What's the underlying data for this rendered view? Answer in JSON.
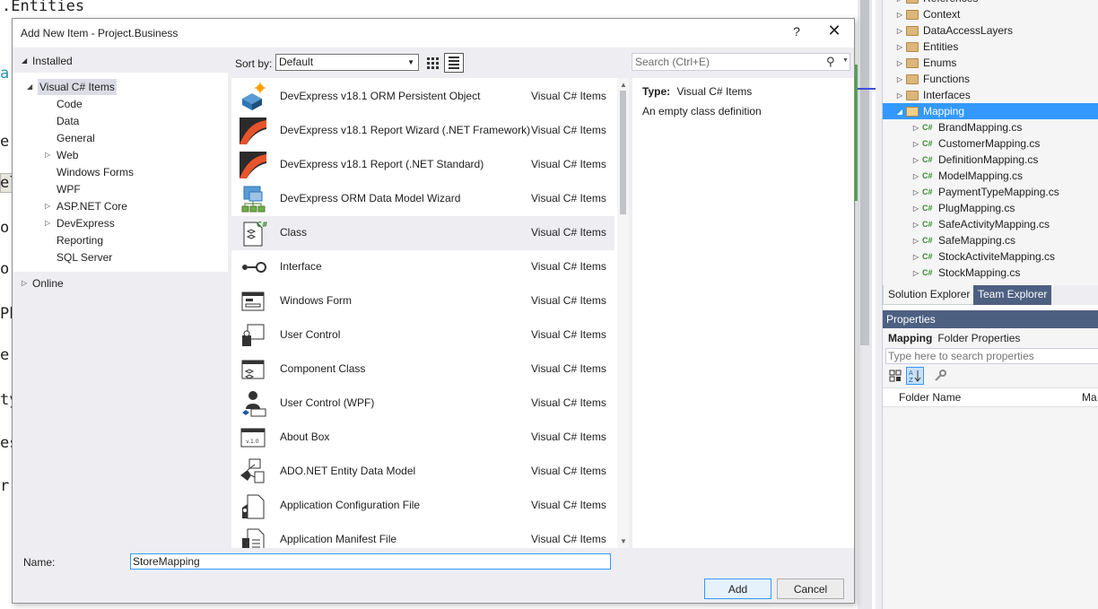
{
  "editor": {
    "fragments": [
      ".Entities",
      "a:",
      "e(",
      "el",
      "or",
      "or",
      "Ph",
      "e",
      "ty",
      "es",
      "r:"
    ]
  },
  "solution_explorer": {
    "items": [
      {
        "label": "References",
        "kind": "folder"
      },
      {
        "label": "Context",
        "kind": "folder"
      },
      {
        "label": "DataAccessLayers",
        "kind": "folder"
      },
      {
        "label": "Entities",
        "kind": "folder"
      },
      {
        "label": "Enums",
        "kind": "folder"
      },
      {
        "label": "Functions",
        "kind": "folder"
      },
      {
        "label": "Interfaces",
        "kind": "folder"
      },
      {
        "label": "Mapping",
        "kind": "folder-open",
        "selected": true
      },
      {
        "label": "BrandMapping.cs",
        "kind": "cs"
      },
      {
        "label": "CustomerMapping.cs",
        "kind": "cs"
      },
      {
        "label": "DefinitionMapping.cs",
        "kind": "cs"
      },
      {
        "label": "ModelMapping.cs",
        "kind": "cs"
      },
      {
        "label": "PaymentTypeMapping.cs",
        "kind": "cs"
      },
      {
        "label": "PlugMapping.cs",
        "kind": "cs"
      },
      {
        "label": "SafeActivityMapping.cs",
        "kind": "cs"
      },
      {
        "label": "SafeMapping.cs",
        "kind": "cs"
      },
      {
        "label": "StockActiviteMapping.cs",
        "kind": "cs"
      },
      {
        "label": "StockMapping.cs",
        "kind": "cs"
      }
    ],
    "cs_badge": "C#",
    "tabs": [
      "Solution Explorer",
      "Team Explorer"
    ]
  },
  "properties": {
    "title": "Properties",
    "object_name": "Mapping",
    "object_type": "Folder Properties",
    "search_placeholder": "Type here to search properties",
    "row_name": "Folder Name",
    "row_value": "Ma"
  },
  "dialog": {
    "title": "Add New Item - Project.Business",
    "help": "?",
    "close": "✕",
    "installed": "Installed",
    "tree": [
      {
        "label": "Visual C# Items",
        "level": 0,
        "expanded": true,
        "selected": true
      },
      {
        "label": "Code",
        "level": 1
      },
      {
        "label": "Data",
        "level": 1
      },
      {
        "label": "General",
        "level": 1
      },
      {
        "label": "Web",
        "level": 1,
        "collapsed": true
      },
      {
        "label": "Windows Forms",
        "level": 1
      },
      {
        "label": "WPF",
        "level": 1
      },
      {
        "label": "ASP.NET Core",
        "level": 1,
        "collapsed": true
      },
      {
        "label": "DevExpress",
        "level": 1,
        "collapsed": true
      },
      {
        "label": "Reporting",
        "level": 1
      },
      {
        "label": "SQL Server",
        "level": 1
      }
    ],
    "online": "Online",
    "sort_label": "Sort by:",
    "sort_value": "Default",
    "search_placeholder": "Search (Ctrl+E)",
    "items": [
      {
        "name": "DevExpress v18.1 ORM Persistent Object",
        "category": "Visual C# Items",
        "icon": "orm-object-icon"
      },
      {
        "name": "DevExpress v18.1 Report Wizard (.NET Framework)",
        "category": "Visual C# Items",
        "icon": "report-wizard-icon"
      },
      {
        "name": "DevExpress v18.1 Report (.NET Standard)",
        "category": "Visual C# Items",
        "icon": "report-icon"
      },
      {
        "name": "DevExpress ORM Data Model Wizard",
        "category": "Visual C# Items",
        "icon": "data-model-icon"
      },
      {
        "name": "Class",
        "category": "Visual C# Items",
        "icon": "class-icon",
        "selected": true
      },
      {
        "name": "Interface",
        "category": "Visual C# Items",
        "icon": "interface-icon"
      },
      {
        "name": "Windows Form",
        "category": "Visual C# Items",
        "icon": "windows-form-icon"
      },
      {
        "name": "User Control",
        "category": "Visual C# Items",
        "icon": "user-control-icon"
      },
      {
        "name": "Component Class",
        "category": "Visual C# Items",
        "icon": "component-class-icon"
      },
      {
        "name": "User Control (WPF)",
        "category": "Visual C# Items",
        "icon": "user-control-wpf-icon"
      },
      {
        "name": "About Box",
        "category": "Visual C# Items",
        "icon": "about-box-icon"
      },
      {
        "name": "ADO.NET Entity Data Model",
        "category": "Visual C# Items",
        "icon": "entity-model-icon"
      },
      {
        "name": "Application Configuration File",
        "category": "Visual C# Items",
        "icon": "config-file-icon"
      },
      {
        "name": "Application Manifest File",
        "category": "Visual C# Items",
        "icon": "manifest-file-icon"
      }
    ],
    "class_badge": "C#",
    "about_badge": "v.1.0",
    "detail": {
      "type_label": "Type:",
      "type_value": "Visual C# Items",
      "description": "An empty class definition"
    },
    "name_label": "Name:",
    "name_value": "StoreMapping",
    "add_label": "Add",
    "cancel_label": "Cancel"
  },
  "colors": {
    "selection": "#3399ff",
    "panel_header": "#4d6082",
    "dialog_bg": "#eeeef2"
  }
}
